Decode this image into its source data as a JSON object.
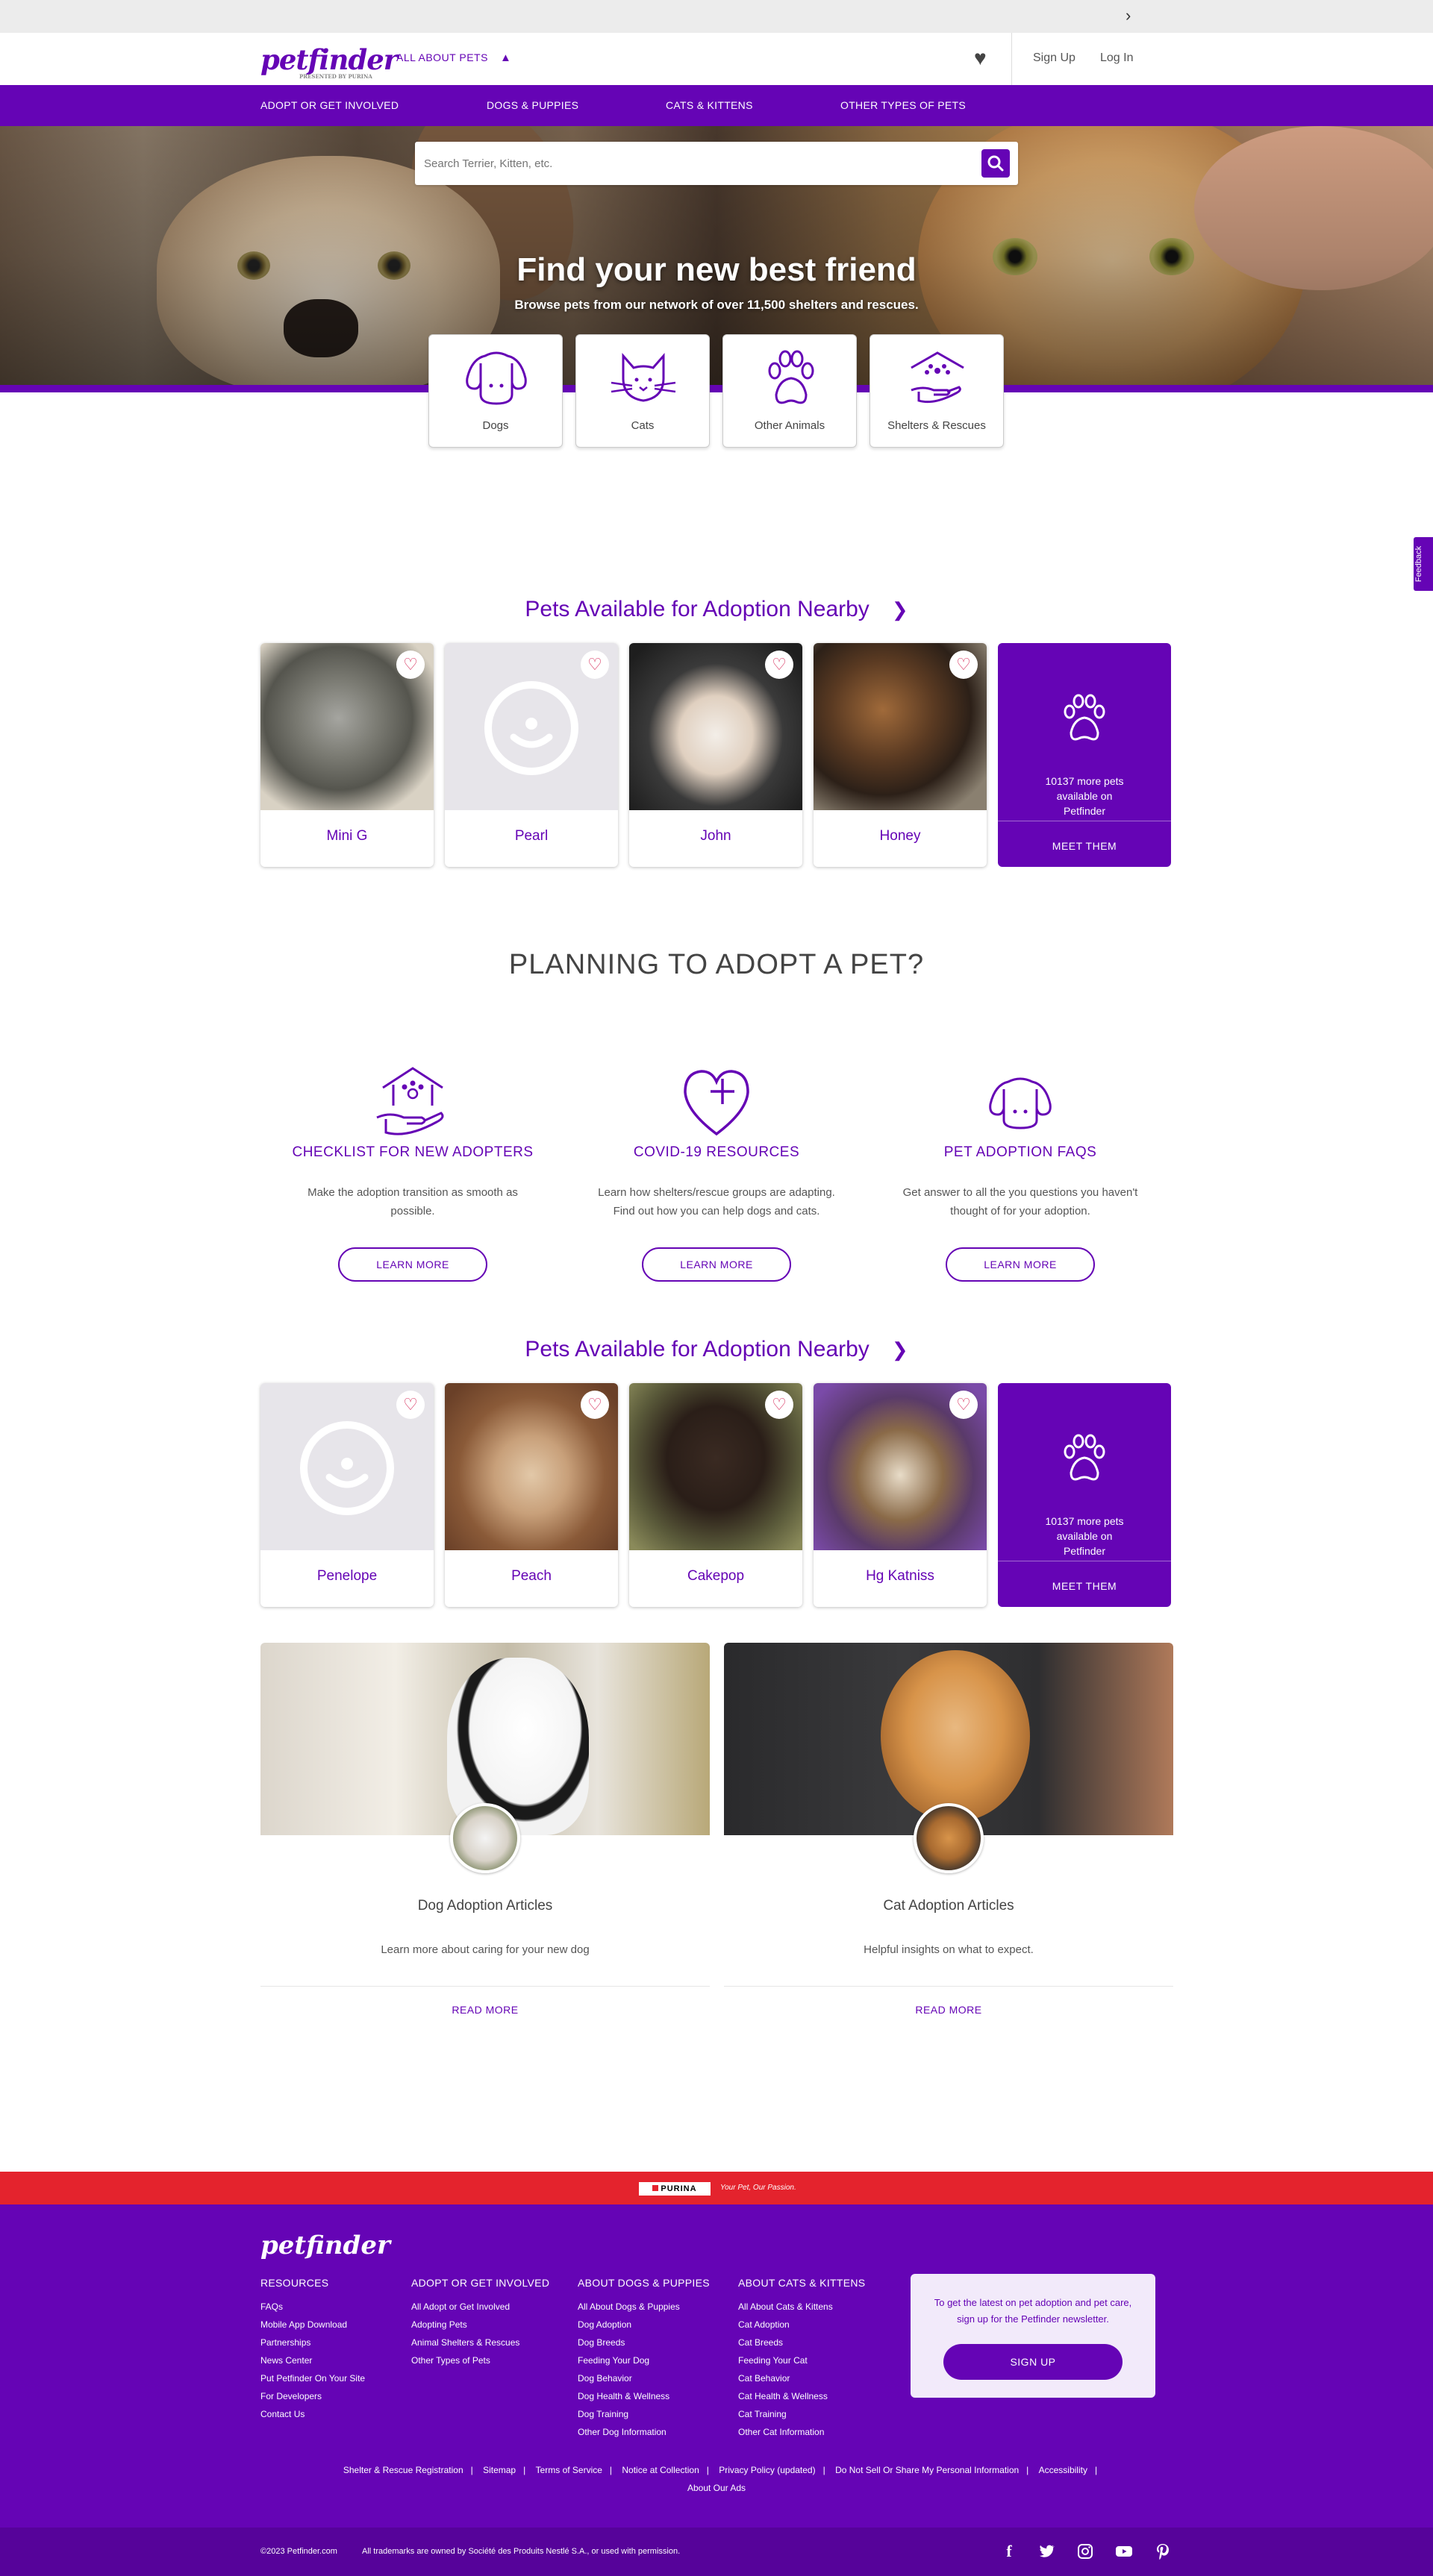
{
  "header": {
    "logo": "petfinder",
    "logo_sub": "PRESENTED BY PURINA",
    "all_about_pets": "ALL ABOUT PETS",
    "sign_up": "Sign Up",
    "log_in": "Log In"
  },
  "nav": [
    "ADOPT OR GET INVOLVED",
    "DOGS & PUPPIES",
    "CATS & KITTENS",
    "OTHER TYPES OF PETS"
  ],
  "hero": {
    "search_placeholder": "Search Terrier, Kitten, etc.",
    "title": "Find your new best friend",
    "subtitle": "Browse pets from our network of over 11,500 shelters and rescues."
  },
  "categories": [
    "Dogs",
    "Cats",
    "Other Animals",
    "Shelters & Rescues"
  ],
  "feedback": "Feedback",
  "nearby1": {
    "title": "Pets Available for Adoption Nearby",
    "pets": [
      "Mini G",
      "Pearl",
      "John",
      "Honey"
    ],
    "more_text": "10137 more pets available on Petfinder",
    "more_cta": "MEET THEM"
  },
  "planning": {
    "title": "PLANNING TO ADOPT A PET?",
    "items": [
      {
        "title": "CHECKLIST FOR NEW ADOPTERS",
        "desc": "Make the adoption transition as smooth as possible.",
        "cta": "LEARN MORE"
      },
      {
        "title": "COVID-19 RESOURCES",
        "desc": "Learn how shelters/rescue groups are adapting. Find out how you can help dogs and cats.",
        "cta": "LEARN MORE"
      },
      {
        "title": "PET ADOPTION FAQS",
        "desc": "Get answer to all the you questions you haven't thought of for your adoption.",
        "cta": "LEARN MORE"
      }
    ]
  },
  "nearby2": {
    "title": "Pets Available for Adoption Nearby",
    "pets": [
      "Penelope",
      "Peach",
      "Cakepop",
      "Hg Katniss"
    ],
    "more_text": "10137 more pets available on Petfinder",
    "more_cta": "MEET THEM"
  },
  "articles": [
    {
      "title": "Dog Adoption Articles",
      "desc": "Learn more about caring for your new dog",
      "cta": "READ MORE"
    },
    {
      "title": "Cat Adoption Articles",
      "desc": "Helpful insights on what to expect.",
      "cta": "READ MORE"
    }
  ],
  "purina": {
    "brand": "PURINA",
    "tagline": "Your Pet, Our Passion."
  },
  "footer": {
    "logo": "petfinder",
    "columns": [
      {
        "heading": "RESOURCES",
        "items": [
          "FAQs",
          "Mobile App Download",
          "Partnerships",
          "News Center",
          "Put Petfinder On Your Site",
          "For Developers",
          "Contact Us"
        ]
      },
      {
        "heading": "ADOPT OR GET INVOLVED",
        "items": [
          "All Adopt or Get Involved",
          "Adopting Pets",
          "Animal Shelters & Rescues",
          "Other Types of Pets"
        ]
      },
      {
        "heading": "ABOUT DOGS & PUPPIES",
        "items": [
          "All About Dogs & Puppies",
          "Dog Adoption",
          "Dog Breeds",
          "Feeding Your Dog",
          "Dog Behavior",
          "Dog Health & Wellness",
          "Dog Training",
          "Other Dog Information"
        ]
      },
      {
        "heading": "ABOUT CATS & KITTENS",
        "items": [
          "All About Cats & Kittens",
          "Cat Adoption",
          "Cat Breeds",
          "Feeding Your Cat",
          "Cat Behavior",
          "Cat Health & Wellness",
          "Cat Training",
          "Other Cat Information"
        ]
      }
    ],
    "newsletter_text": "To get the latest on pet adoption and pet care, sign up for the Petfinder newsletter.",
    "newsletter_cta": "SIGN UP",
    "links": [
      "Shelter & Rescue Registration",
      "Sitemap",
      "Terms of Service",
      "Notice at Collection",
      "Privacy Policy (updated)",
      "Do Not Sell Or Share My Personal Information",
      "Accessibility"
    ],
    "about_ads": "About Our Ads",
    "copyright": "©2023 Petfinder.com",
    "trademark": "All trademarks are owned by Société des Produits Nestlé S.A., or used with permission."
  },
  "colors": {
    "brand": "#6504b5",
    "purina_red": "#e4232d",
    "heart": "#d62d5a"
  }
}
